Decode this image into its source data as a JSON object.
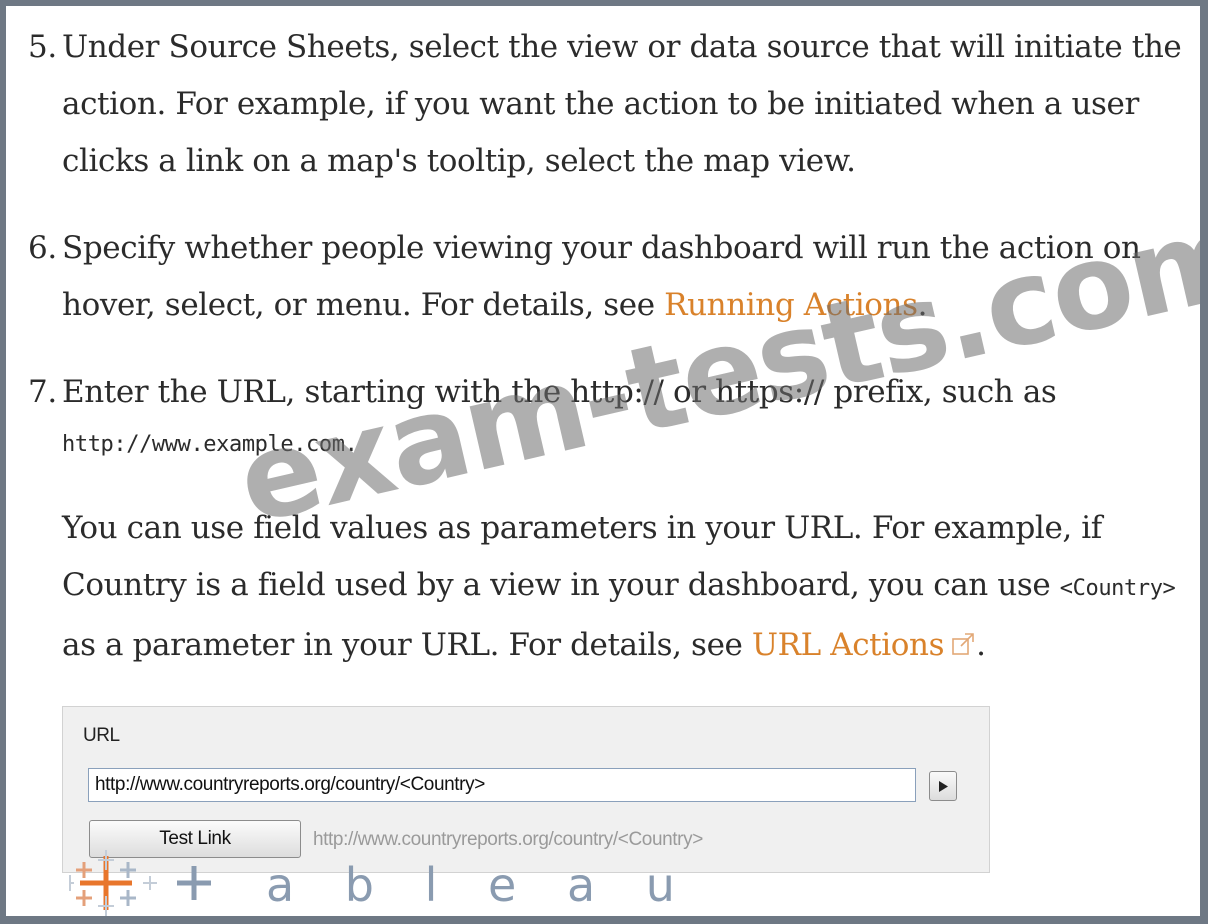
{
  "steps": [
    {
      "number": "5.",
      "text": "Under Source Sheets, select the view or data source that will initiate the action. For example, if you want the action to be initiated when a user clicks a link on a map's tooltip, select the map view."
    },
    {
      "number": "6.",
      "text_before": "Specify whether people viewing your dashboard will run the action on hover, select, or menu. For details, see ",
      "link": "Running Actions",
      "text_after": "."
    },
    {
      "number": "7.",
      "text": "Enter the URL, starting with the http:// or https:// prefix, such as",
      "code": "http://www.example.com.",
      "para_before": "You can use field values as parameters in your URL. For example, if Country is a field used by a view in your dashboard, you can use ",
      "para_code": "<Country>",
      "para_middle": " as a parameter in your URL. For details, see ",
      "para_link": "URL Actions",
      "para_after": "."
    }
  ],
  "url_panel": {
    "label": "URL",
    "input_value": "http://www.countryreports.org/country/<Country>",
    "test_button": "Test Link",
    "preview": "http://www.countryreports.org/country/<Country>"
  },
  "watermark": "exam-tests.com",
  "logo": "tableau",
  "colors": {
    "link": "#d9822b",
    "text": "#2b2b2b",
    "border": "#6e7884"
  }
}
